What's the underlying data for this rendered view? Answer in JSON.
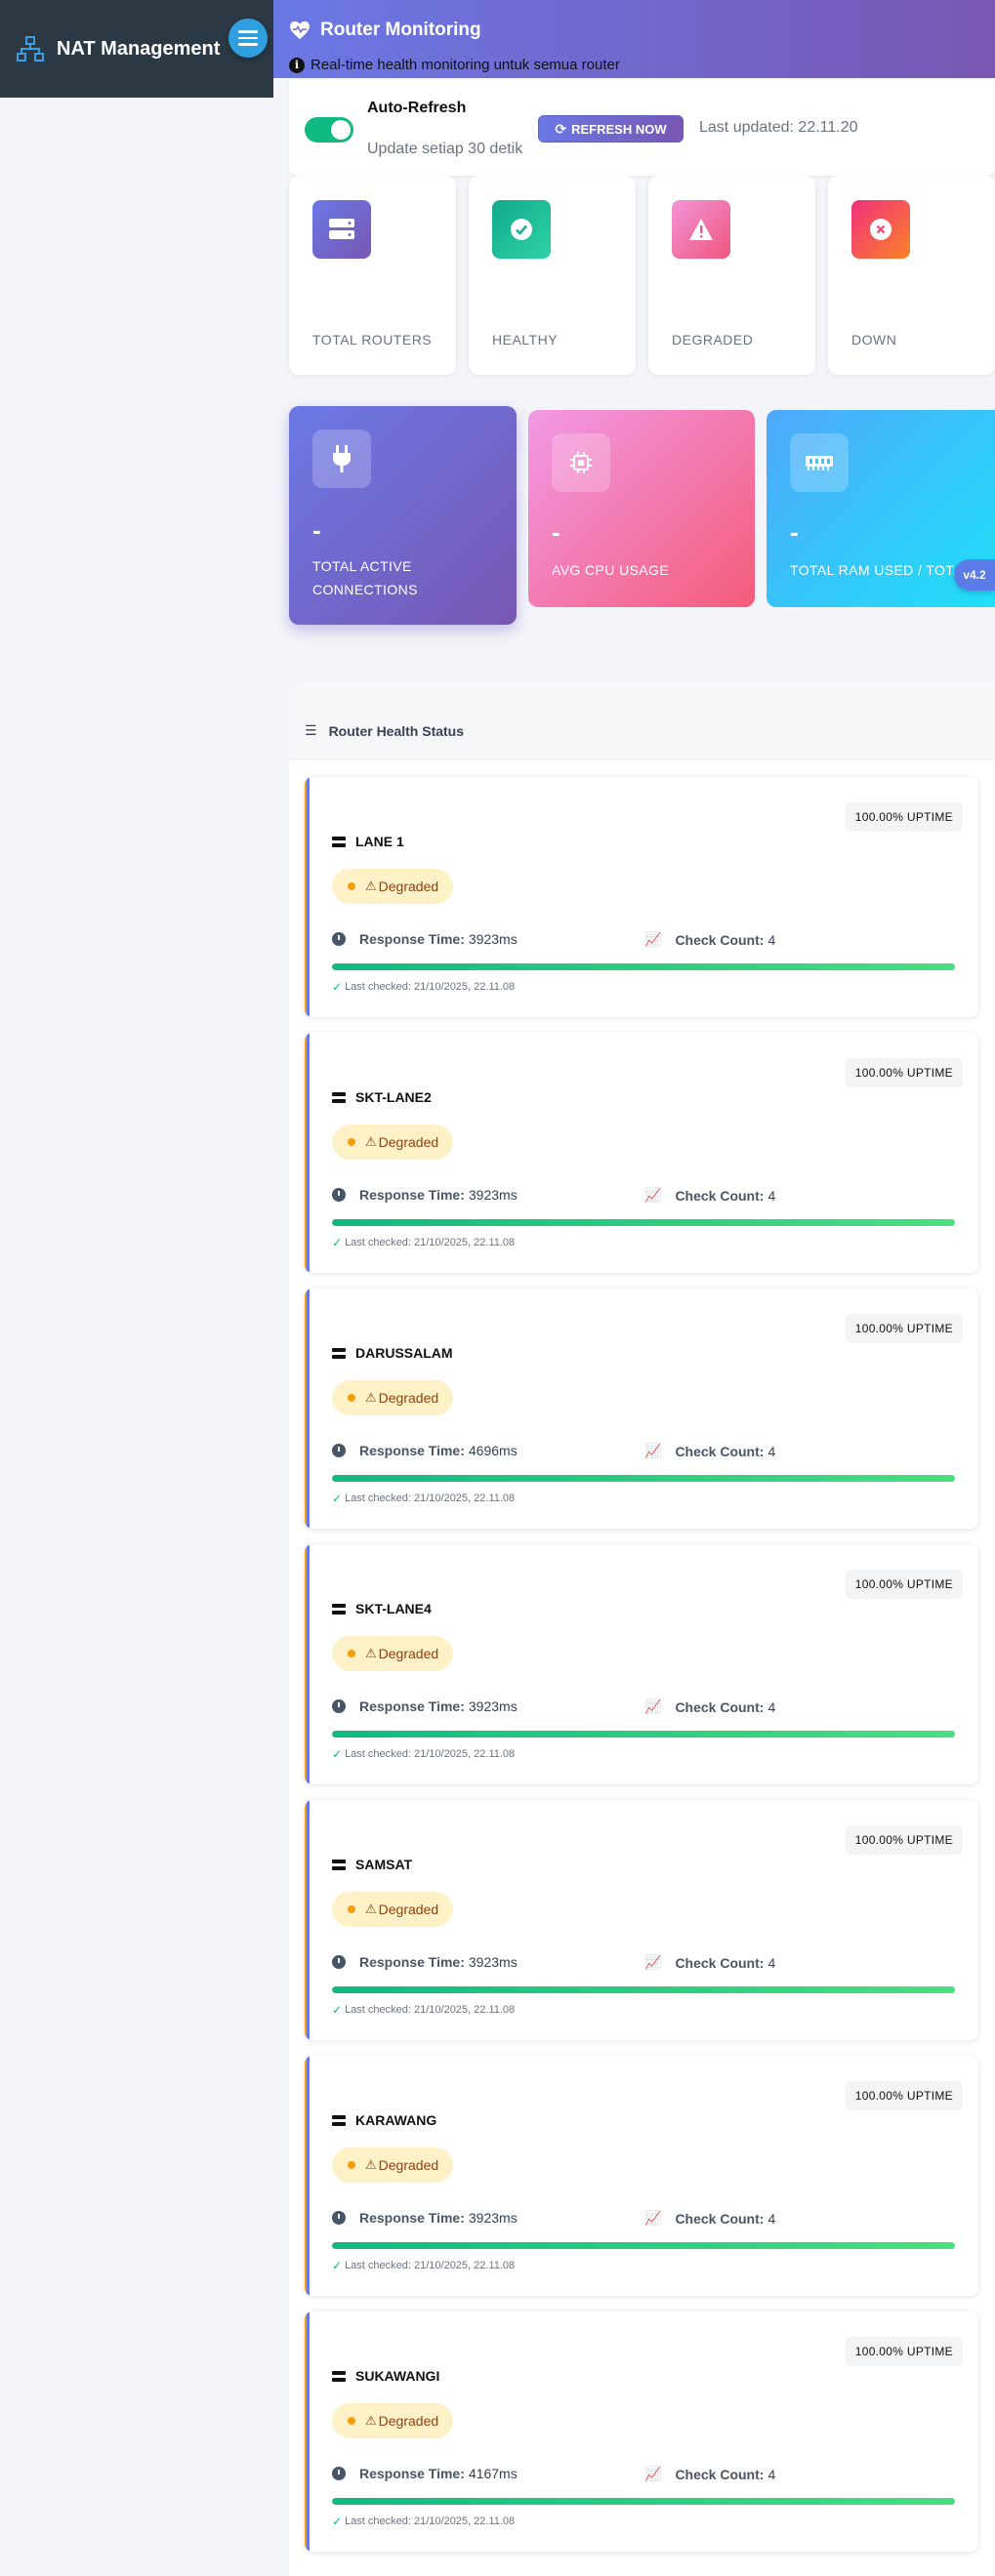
{
  "sidebar": {
    "brand_title": "NAT Management",
    "brand_icon": "network-icon",
    "menu_icon": "hamburger-icon"
  },
  "header": {
    "title": "Router Monitoring",
    "subtitle": "Real-time health monitoring untuk semua router",
    "icon": "heart-pulse-icon"
  },
  "refresh": {
    "auto_refresh_label": "Auto-Refresh",
    "auto_refresh_sub": "Update setiap 30 detik",
    "auto_refresh_on": true,
    "button_label": "REFRESH NOW",
    "last_updated": "Last updated: 22.11.20"
  },
  "stats": [
    {
      "label": "TOTAL ROUTERS",
      "icon": "server-icon",
      "color": "#7a6cd6"
    },
    {
      "label": "HEALTHY",
      "icon": "check-circle-icon",
      "color": "#16b39a"
    },
    {
      "label": "DEGRADED",
      "icon": "warning-icon",
      "color": "#f06aa8"
    },
    {
      "label": "DOWN",
      "icon": "x-circle-icon",
      "color": "#f2476b"
    }
  ],
  "metrics": [
    {
      "value": "-",
      "label": "TOTAL ACTIVE CONNECTIONS",
      "icon": "plug-icon"
    },
    {
      "value": "-",
      "label": "AVG CPU USAGE",
      "icon": "cpu-icon"
    },
    {
      "value": "-",
      "label": "TOTAL RAM USED / TOTAL",
      "icon": "memory-icon"
    }
  ],
  "version": "v4.2",
  "health": {
    "title": "Router Health Status",
    "routers": [
      {
        "name": "LANE 1",
        "uptime": "100.00% UPTIME",
        "status": "Degraded",
        "response_label": "Response Time:",
        "response": "3923ms",
        "check_label": "Check Count:",
        "check": "4",
        "progress": 100,
        "last_checked": "Last checked: 21/10/2025, 22.11.08"
      },
      {
        "name": "SKT-LANE2",
        "uptime": "100.00% UPTIME",
        "status": "Degraded",
        "response_label": "Response Time:",
        "response": "3923ms",
        "check_label": "Check Count:",
        "check": "4",
        "progress": 100,
        "last_checked": "Last checked: 21/10/2025, 22.11.08"
      },
      {
        "name": "DARUSSALAM",
        "uptime": "100.00% UPTIME",
        "status": "Degraded",
        "response_label": "Response Time:",
        "response": "4696ms",
        "check_label": "Check Count:",
        "check": "4",
        "progress": 100,
        "last_checked": "Last checked: 21/10/2025, 22.11.08"
      },
      {
        "name": "SKT-LANE4",
        "uptime": "100.00% UPTIME",
        "status": "Degraded",
        "response_label": "Response Time:",
        "response": "3923ms",
        "check_label": "Check Count:",
        "check": "4",
        "progress": 100,
        "last_checked": "Last checked: 21/10/2025, 22.11.08"
      },
      {
        "name": "SAMSAT",
        "uptime": "100.00% UPTIME",
        "status": "Degraded",
        "response_label": "Response Time:",
        "response": "3923ms",
        "check_label": "Check Count:",
        "check": "4",
        "progress": 100,
        "last_checked": "Last checked: 21/10/2025, 22.11.08"
      },
      {
        "name": "KARAWANG",
        "uptime": "100.00% UPTIME",
        "status": "Degraded",
        "response_label": "Response Time:",
        "response": "3923ms",
        "check_label": "Check Count:",
        "check": "4",
        "progress": 100,
        "last_checked": "Last checked: 21/10/2025, 22.11.08"
      },
      {
        "name": "SUKAWANGI",
        "uptime": "100.00% UPTIME",
        "status": "Degraded",
        "response_label": "Response Time:",
        "response": "4167ms",
        "check_label": "Check Count:",
        "check": "4",
        "progress": 100,
        "last_checked": "Last checked: 21/10/2025, 22.11.08"
      }
    ]
  }
}
